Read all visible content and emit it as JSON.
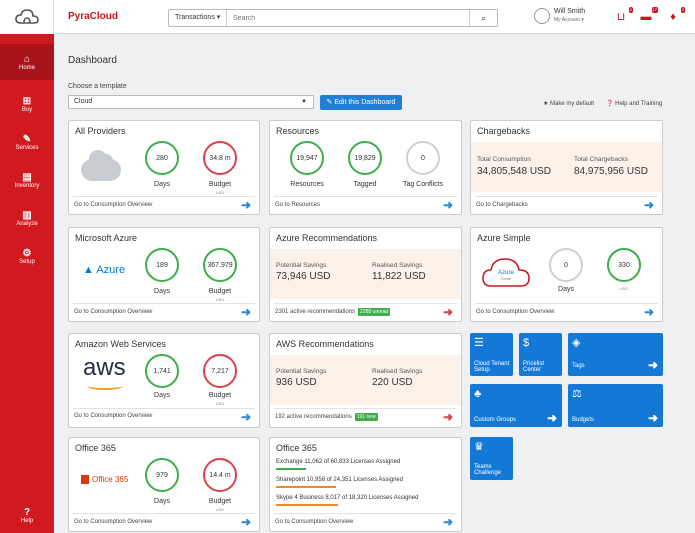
{
  "app": {
    "brand": "PyraCloud"
  },
  "nav": [
    {
      "label": "Home",
      "icon": "home-icon",
      "glyph": "⌂",
      "active": true
    },
    {
      "label": "Buy",
      "icon": "cart-icon",
      "glyph": "🛒"
    },
    {
      "label": "Services",
      "icon": "wrench-icon",
      "glyph": "🔧"
    },
    {
      "label": "Inventory",
      "icon": "document-icon",
      "glyph": "▤"
    },
    {
      "label": "Analyze",
      "icon": "bar-chart-icon",
      "glyph": "▥"
    },
    {
      "label": "Setup",
      "icon": "gear-icon",
      "glyph": "⚙"
    },
    {
      "label": "Help",
      "icon": "help-icon",
      "glyph": "?"
    }
  ],
  "search": {
    "category": "Transactions ▾",
    "placeholder": "Search",
    "button_icon": "search-icon"
  },
  "user": {
    "name": "Will Smith",
    "account": "My Account ▾"
  },
  "header_icons": [
    {
      "name": "cart-icon",
      "badge": "0"
    },
    {
      "name": "truck-icon",
      "badge": "17"
    },
    {
      "name": "bell-icon",
      "badge": "2"
    }
  ],
  "dashboard": {
    "title": "Dashboard",
    "choose_label": "Choose a template",
    "template_value": "Cloud",
    "edit_button": "✎ Edit this Dashboard",
    "make_default": "★ Make my default",
    "help_training": "❓ Help and Training"
  },
  "cards": {
    "all_providers": {
      "title": "All Providers",
      "days": "280",
      "budget": "34.8 m",
      "days_label": "Days",
      "budget_label": "Budget",
      "budget_unit": "USD",
      "link": "Go to Consumption Overview"
    },
    "resources": {
      "title": "Resources",
      "resources": "19,947",
      "tagged": "19,829",
      "conflicts": "0",
      "l1": "Resources",
      "l2": "Tagged",
      "l3": "Tag Conflicts",
      "link": "Go to Resources"
    },
    "chargebacks": {
      "title": "Chargebacks",
      "l1": "Total Consumption",
      "v1": "34,805,548 USD",
      "l2": "Total Chargebacks",
      "v2": "84,975,956 USD",
      "link": "Go to Chargebacks"
    },
    "azure": {
      "title": "Microsoft Azure",
      "logo": "Azure",
      "days": "189",
      "budget": "367,979",
      "days_label": "Days",
      "budget_label": "Budget",
      "budget_unit": "USD",
      "link": "Go to Consumption Overview"
    },
    "azure_rec": {
      "title": "Azure Recommendations",
      "l1": "Potential Savings",
      "v1": "73,946 USD",
      "l2": "Realised Savings",
      "v2": "11,822 USD",
      "foot": "2301 active recommendations",
      "badge": "2288 unread"
    },
    "azure_simple": {
      "title": "Azure Simple",
      "cloud_label": "Azure",
      "cloud_sub": "Simple",
      "days": "0",
      "budget": "330",
      "days_label": "Days",
      "budget_unit": "USD",
      "link": "Go to Consumption Overview"
    },
    "aws": {
      "title": "Amazon Web Services",
      "logo": "aws",
      "days": "1,741",
      "budget": "7,217",
      "days_label": "Days",
      "budget_label": "Budget",
      "budget_unit": "USD",
      "link": "Go to Consumption Overview"
    },
    "aws_rec": {
      "title": "AWS Recommendations",
      "l1": "Potential Savings",
      "v1": "936 USD",
      "l2": "Realised Savings",
      "v2": "220 USD",
      "foot": "192 active recommendations",
      "badge": "191 new"
    },
    "office": {
      "title": "Office 365",
      "logo": "Office 365",
      "days": "979",
      "budget": "14.4 m",
      "days_label": "Days",
      "budget_label": "Budget",
      "budget_unit": "USD",
      "link": "Go to Consumption Overview"
    },
    "office_lic": {
      "title": "Office 365",
      "l1": "Exchange 11,062 of 60,833 Licenses Assigned",
      "l2": "Sharepoint 10,958 of 24,351 Licenses Assigned",
      "l3": "Skype 4 Business 8,017 of 18,320 Licenses Assigned",
      "link": "Go to Consumption Overview",
      "c1": "#3dae4a",
      "c2": "#f08a24",
      "c3": "#f08a24"
    }
  },
  "tiles": {
    "cloud_tenant": "Cloud Tenant\nSetup",
    "pricelist": "Pricelist\nCenter",
    "tags": "Tags",
    "custom_groups": "Custom Groups",
    "budgets": "Budgets",
    "teams": "Teams\nChallenge"
  },
  "colors": {
    "brand": "#d11a1f",
    "accent": "#1479d6",
    "good": "#3dae4a",
    "bad": "#d9424b"
  }
}
